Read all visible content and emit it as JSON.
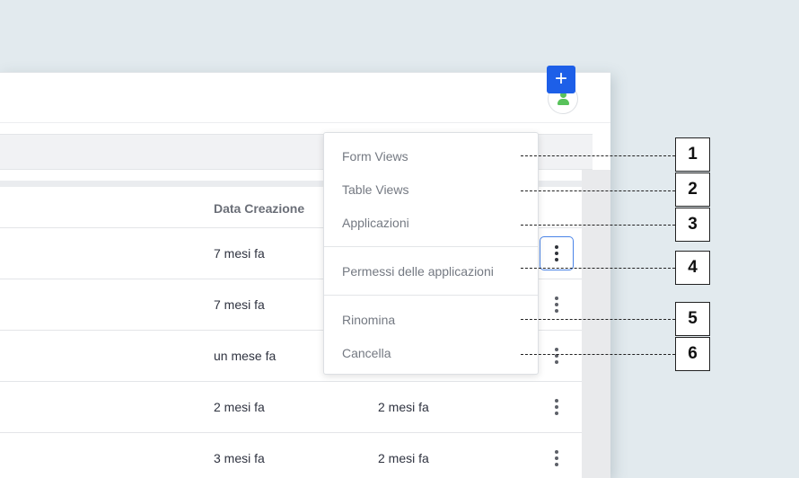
{
  "header": {
    "avatar_icon": "user-icon"
  },
  "toolbar": {
    "add_label": "+"
  },
  "table": {
    "columns": {
      "created": "Data Creazione"
    },
    "rows": [
      {
        "created": "7 mesi fa",
        "modified": ""
      },
      {
        "created": "7 mesi fa",
        "modified": ""
      },
      {
        "created": "un mese fa",
        "modified": ""
      },
      {
        "created": "2 mesi fa",
        "modified": "2 mesi fa"
      },
      {
        "created": "3 mesi fa",
        "modified": "2 mesi fa"
      }
    ]
  },
  "menu": {
    "items": [
      {
        "label": "Form Views"
      },
      {
        "label": "Table Views"
      },
      {
        "label": "Applicazioni"
      },
      {
        "label": "Permessi delle applicazioni"
      },
      {
        "label": "Rinomina"
      },
      {
        "label": "Cancella"
      }
    ]
  },
  "callouts": [
    "1",
    "2",
    "3",
    "4",
    "5",
    "6"
  ],
  "colors": {
    "accent": "#1d5fe8",
    "avatar": "#58c25b",
    "background": "#e2eaee"
  }
}
